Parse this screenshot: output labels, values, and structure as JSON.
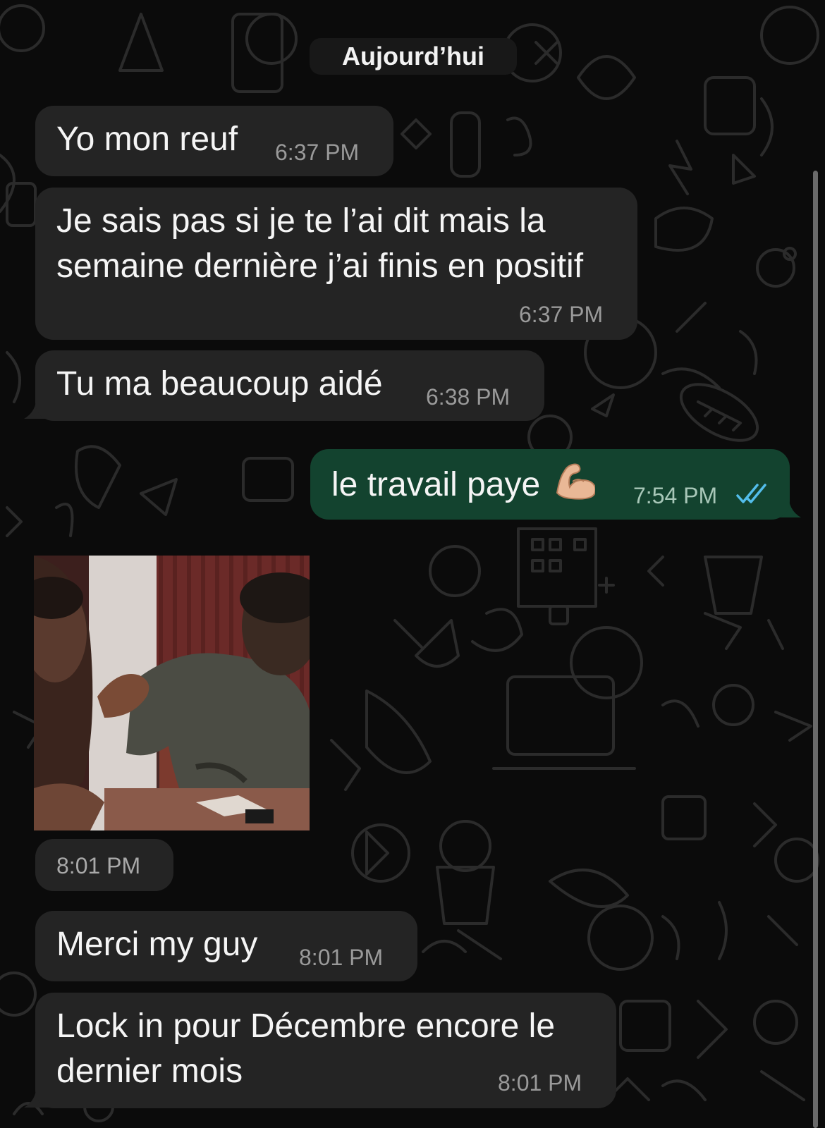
{
  "date_separator": "Aujourd’hui",
  "messages": [
    {
      "direction": "incoming",
      "text_lines": [
        "Yo mon reuf"
      ],
      "time": "6:37 PM"
    },
    {
      "direction": "incoming",
      "text_lines": [
        "Je sais pas si je te l’ai dit mais la",
        "semaine dernière j’ai finis en positif"
      ],
      "time": "6:37 PM"
    },
    {
      "direction": "incoming",
      "text_lines": [
        "Tu ma beaucoup aidé"
      ],
      "time": "6:38 PM"
    },
    {
      "direction": "outgoing",
      "text_lines": [
        "le travail paye"
      ],
      "emoji": "flexed-biceps",
      "time": "7:54 PM",
      "status": "read"
    },
    {
      "direction": "incoming",
      "type": "image",
      "image_description": "two men, one reaching out his hand",
      "time": "8:01 PM"
    },
    {
      "direction": "incoming",
      "text_lines": [
        "Merci my guy"
      ],
      "time": "8:01 PM"
    },
    {
      "direction": "incoming",
      "text_lines": [
        "Lock in pour Décembre encore le",
        "dernier mois"
      ],
      "time": "8:01 PM"
    }
  ],
  "colors": {
    "background": "#0b0b0b",
    "incoming_bubble": "#242424",
    "outgoing_bubble": "#13432f",
    "read_ticks": "#53bdeb",
    "timestamp": "#9a9a9a"
  }
}
